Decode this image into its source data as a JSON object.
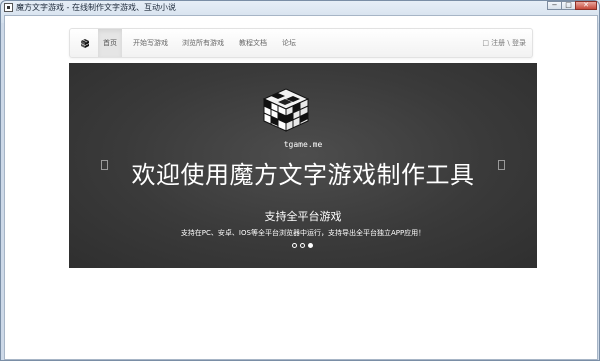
{
  "window": {
    "title": "魔方文字游戏 - 在线制作文字游戏、互动小说",
    "buttons": [
      "−",
      "□",
      "✕"
    ]
  },
  "navbar": {
    "brand_icon": "rubiks-cube-icon",
    "items": [
      {
        "label": "首页",
        "active": true
      },
      {
        "label": "开始写游戏",
        "active": false
      },
      {
        "label": "浏览所有游戏",
        "active": false
      },
      {
        "label": "教程文档",
        "active": false
      },
      {
        "label": "论坛",
        "active": false
      }
    ],
    "user_links": "□ 注册 \\ 登录"
  },
  "carousel": {
    "logo_icon": "rubiks-cube-logo",
    "site_tag": "tgame.me",
    "headline": "欢迎使用魔方文字游戏制作工具",
    "subtitle": "支持全平台游戏",
    "description": "支持在PC、安卓、IOS等全平台浏览器中运行，支持导出全平台独立APP应用！",
    "slide_count": 3,
    "active_slide": 3
  }
}
